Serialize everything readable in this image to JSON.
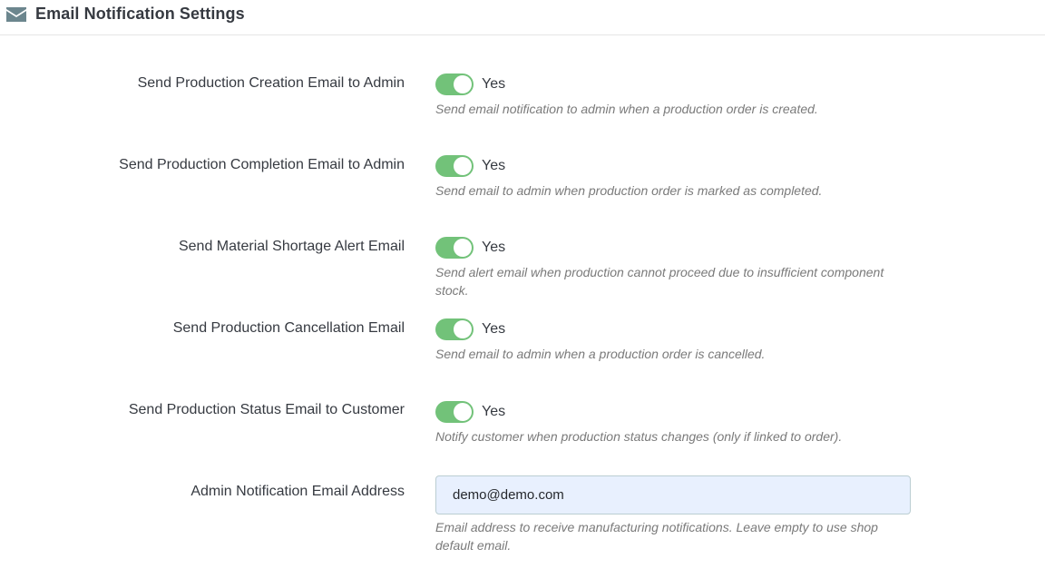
{
  "header": {
    "title": "Email Notification Settings",
    "icon": "envelope-icon"
  },
  "colors": {
    "toggle_on": "#72c279",
    "input_bg": "#e8f0fe",
    "help_text": "#7a7a7a"
  },
  "settings": [
    {
      "label": "Send Production Creation Email to Admin",
      "value": "Yes",
      "help": "Send email notification to admin when a production order is created."
    },
    {
      "label": "Send Production Completion Email to Admin",
      "value": "Yes",
      "help": "Send email to admin when production order is marked as completed."
    },
    {
      "label": "Send Material Shortage Alert Email",
      "value": "Yes",
      "help": "Send alert email when production cannot proceed due to insufficient component stock."
    },
    {
      "label": "Send Production Cancellation Email",
      "value": "Yes",
      "help": "Send email to admin when a production order is cancelled."
    },
    {
      "label": "Send Production Status Email to Customer",
      "value": "Yes",
      "help": "Notify customer when production status changes (only if linked to order)."
    }
  ],
  "admin_email": {
    "label": "Admin Notification Email Address",
    "value": "demo@demo.com",
    "help": "Email address to receive manufacturing notifications. Leave empty to use shop default email."
  }
}
